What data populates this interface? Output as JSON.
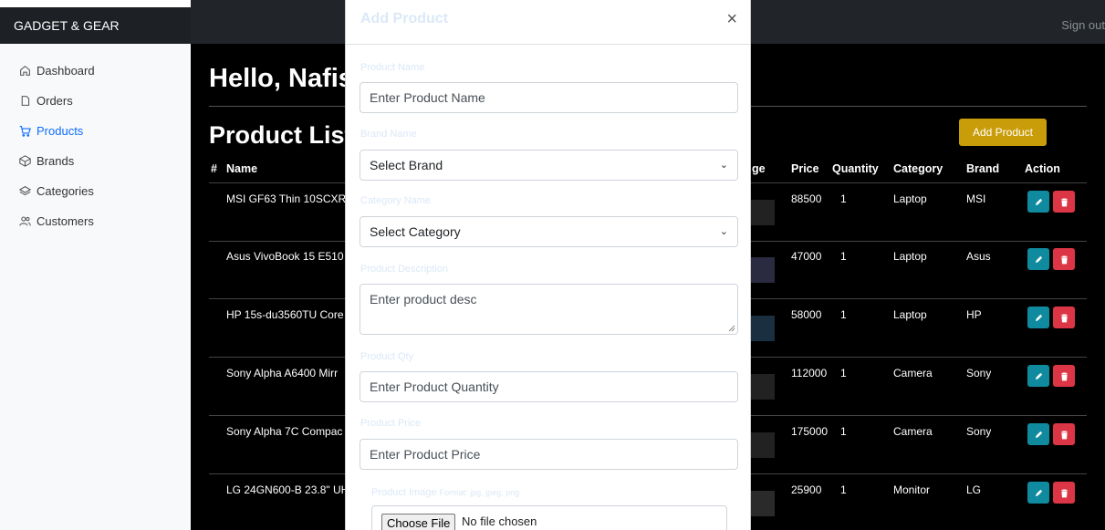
{
  "topbar": {
    "brand": "GADGET & GEAR",
    "signout": "Sign out"
  },
  "sidebar": {
    "items": [
      {
        "label": "Dashboard",
        "icon": "home-icon",
        "active": false
      },
      {
        "label": "Orders",
        "icon": "file-icon",
        "active": false
      },
      {
        "label": "Products",
        "icon": "cart-icon",
        "active": true
      },
      {
        "label": "Brands",
        "icon": "box-icon",
        "active": false
      },
      {
        "label": "Categories",
        "icon": "layers-icon",
        "active": false
      },
      {
        "label": "Customers",
        "icon": "users-icon",
        "active": false
      }
    ]
  },
  "main": {
    "greeting": "Hello, Nafis",
    "list_title": "Product List",
    "add_button": "Add Product",
    "table": {
      "headers": [
        "#",
        "Name",
        "ge",
        "Price",
        "Quantity",
        "Category",
        "Brand",
        "Action"
      ],
      "rows": [
        {
          "name": "MSI GF63 Thin 10SCXR",
          "price": "88500",
          "qty": "1",
          "category": "Laptop",
          "brand": "MSI"
        },
        {
          "name": "Asus VivoBook 15 E510",
          "price": "47000",
          "qty": "1",
          "category": "Laptop",
          "brand": "Asus"
        },
        {
          "name": "HP 15s-du3560TU Core",
          "price": "58000",
          "qty": "1",
          "category": "Laptop",
          "brand": "HP"
        },
        {
          "name": "Sony Alpha A6400 Mirr",
          "price": "112000",
          "qty": "1",
          "category": "Camera",
          "brand": "Sony"
        },
        {
          "name": "Sony Alpha 7C Compac",
          "price": "175000",
          "qty": "1",
          "category": "Camera",
          "brand": "Sony"
        },
        {
          "name": "LG 24GN600-B 23.8\" UH",
          "price": "25900",
          "qty": "1",
          "category": "Monitor",
          "brand": "LG"
        }
      ]
    }
  },
  "modal": {
    "title": "Add Product",
    "close": "×",
    "fields": {
      "name_label": "Product Name",
      "name_placeholder": "Enter Product Name",
      "brand_label": "Brand Name",
      "brand_value": "Select Brand",
      "category_label": "Category Name",
      "category_value": "Select Category",
      "desc_label": "Product Description",
      "desc_placeholder": "Enter product desc",
      "qty_label": "Product Qty",
      "qty_placeholder": "Enter Product Quantity",
      "price_label": "Product Price",
      "price_placeholder": "Enter Product Price",
      "image_label": "Product Image",
      "image_hint": "Format: jpg, jpeg, png",
      "file_button": "Choose File",
      "file_status": "No file chosen"
    }
  },
  "colors": {
    "accent": "#0d6efd",
    "edit": "#0f8a9e",
    "delete": "#dc3545",
    "add": "#c99d0a"
  }
}
